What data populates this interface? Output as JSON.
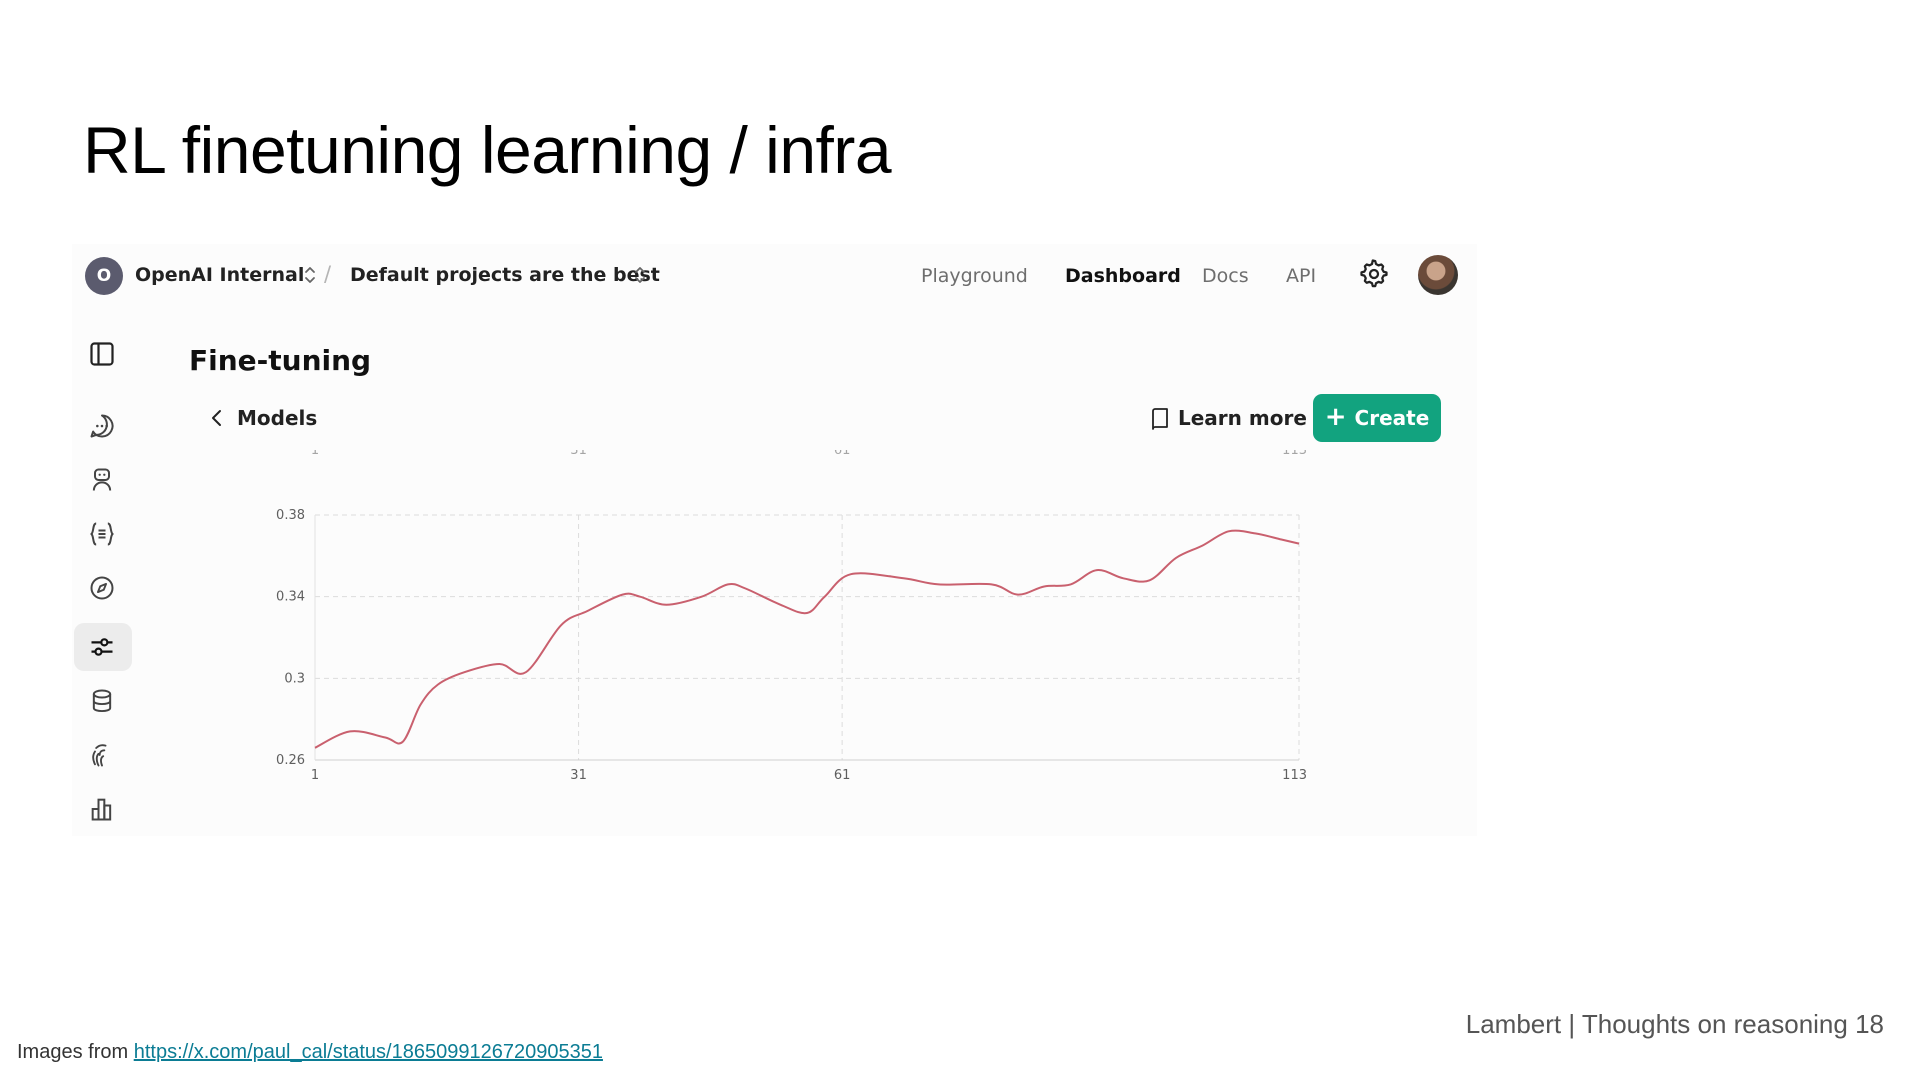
{
  "slide": {
    "title": "RL finetuning learning / infra",
    "footer": "Lambert | Thoughts on reasoning  18",
    "source_prefix": "Images from ",
    "source_url": "https://x.com/paul_cal/status/1865099126720905351"
  },
  "topbar": {
    "org_initial": "O",
    "org_name": "OpenAI Internal",
    "separator": "/",
    "project_name": "Default projects are the best",
    "nav": [
      "Playground",
      "Dashboard",
      "Docs",
      "API"
    ],
    "active_nav": "Dashboard"
  },
  "sidebar": {
    "icons": [
      "panel-icon",
      "chat-icon",
      "assistant-icon",
      "batch-icon",
      "compass-icon",
      "finetune-icon",
      "storage-icon",
      "fingerprint-icon",
      "usage-chart-icon"
    ],
    "active": "finetune-icon"
  },
  "page": {
    "heading": "Fine-tuning",
    "back_label": "Models",
    "learn_more": "Learn more",
    "create_label": "Create"
  },
  "colors": {
    "accent": "#12a37f",
    "line": "#c9606e"
  },
  "chart_data": {
    "type": "line",
    "x_ticks": [
      "1",
      "31",
      "61",
      "113"
    ],
    "y_ticks": [
      "0.38",
      "0.34",
      "0.3",
      "0.26"
    ],
    "xlim": [
      1,
      113
    ],
    "ylim": [
      0.26,
      0.38
    ],
    "grid": true,
    "series": [
      {
        "x": [
          1,
          5,
          9,
          11,
          13,
          15,
          18,
          22,
          25,
          29,
          32,
          36,
          38,
          41,
          45,
          48,
          50,
          54,
          57,
          59,
          62,
          68,
          72,
          78,
          81,
          84,
          87,
          90,
          93,
          96,
          99,
          102,
          105,
          108,
          111,
          113
        ],
        "y": [
          0.266,
          0.274,
          0.271,
          0.269,
          0.287,
          0.297,
          0.303,
          0.307,
          0.303,
          0.326,
          0.333,
          0.341,
          0.34,
          0.336,
          0.34,
          0.346,
          0.344,
          0.336,
          0.332,
          0.34,
          0.351,
          0.349,
          0.346,
          0.346,
          0.341,
          0.345,
          0.346,
          0.353,
          0.349,
          0.348,
          0.359,
          0.365,
          0.372,
          0.371,
          0.368,
          0.366
        ]
      }
    ]
  }
}
